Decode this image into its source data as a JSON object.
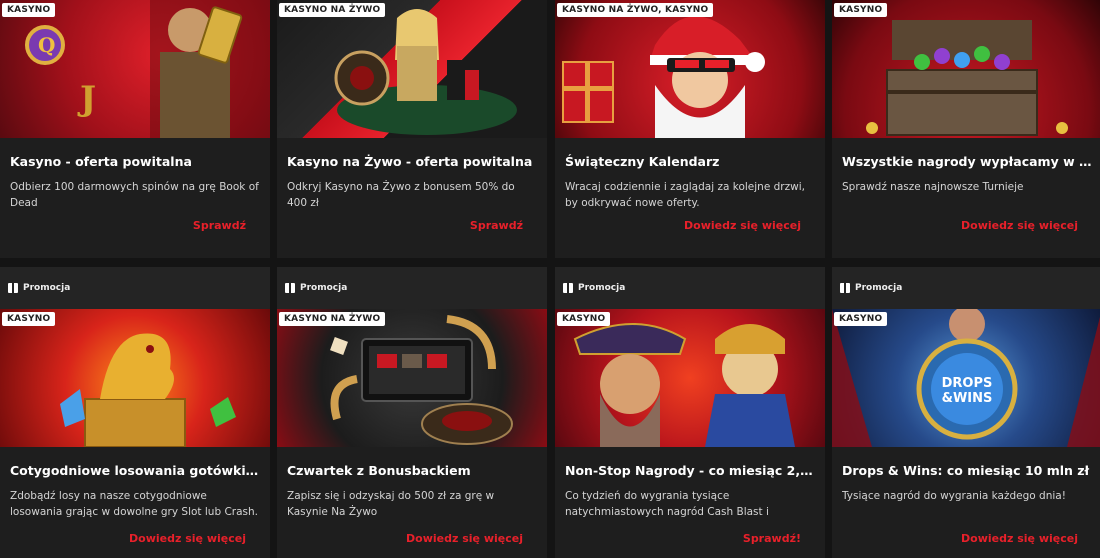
{
  "section_label": "Promocja",
  "cta_colors": {
    "accent": "#e8202a"
  },
  "row1": [
    {
      "badge": "KASYNO",
      "title": "Kasyno - oferta powitalna",
      "desc": "Odbierz 100 darmowych spinów na grę Book of Dead",
      "cta": "Sprawdź"
    },
    {
      "badge": "KASYNO NA ŻYWO",
      "title": "Kasyno na Żywo - oferta powitalna",
      "desc": "Odkryj Kasyno na Żywo z bonusem 50% do 400 zł",
      "cta": "Sprawdź"
    },
    {
      "badge": "KASYNO NA ŻYWO, KASYNO",
      "title": "Świąteczny Kalendarz",
      "desc": "Wracaj codziennie i zaglądaj za kolejne drzwi, by odkrywać nowe oferty.",
      "cta": "Dowiedz się więcej"
    },
    {
      "badge": "KASYNO",
      "title": "Wszystkie nagrody wypłacamy w gotów...",
      "desc": "Sprawdź nasze najnowsze Turnieje",
      "cta": "Dowiedz się więcej"
    }
  ],
  "row2": [
    {
      "tag": "Promocja",
      "badge": "KASYNO",
      "title": "Cotygodniowe losowania gotówki 125 0...",
      "desc": "Zdobądź losy na nasze cotygodniowe losowania grając w dowolne gry Slot lub Crash.",
      "cta": "Dowiedz się więcej"
    },
    {
      "tag": "Promocja",
      "badge": "KASYNO NA ŻYWO",
      "title": "Czwartek z Bonusbackiem",
      "desc": "Zapisz się i odzyskaj do 500 zł za grę w Kasynie Na Żywo",
      "cta": "Dowiedz się więcej"
    },
    {
      "tag": "Promocja",
      "badge": "KASYNO",
      "title": "Non-Stop Nagrody - co miesiąc 2,4 mln ...",
      "desc": "Co tydzień do wygrania tysiące natychmiastowych nagród Cash Blast i",
      "cta": "Sprawdź!"
    },
    {
      "tag": "Promocja",
      "badge": "KASYNO",
      "title": "Drops & Wins: co miesiąc 10 mln zł",
      "desc": "Tysiące nagród do wygrania każdego dnia!",
      "cta": "Dowiedz się więcej"
    }
  ],
  "art": {
    "drops_line1": "DROPS",
    "drops_line2": "&WINS"
  }
}
